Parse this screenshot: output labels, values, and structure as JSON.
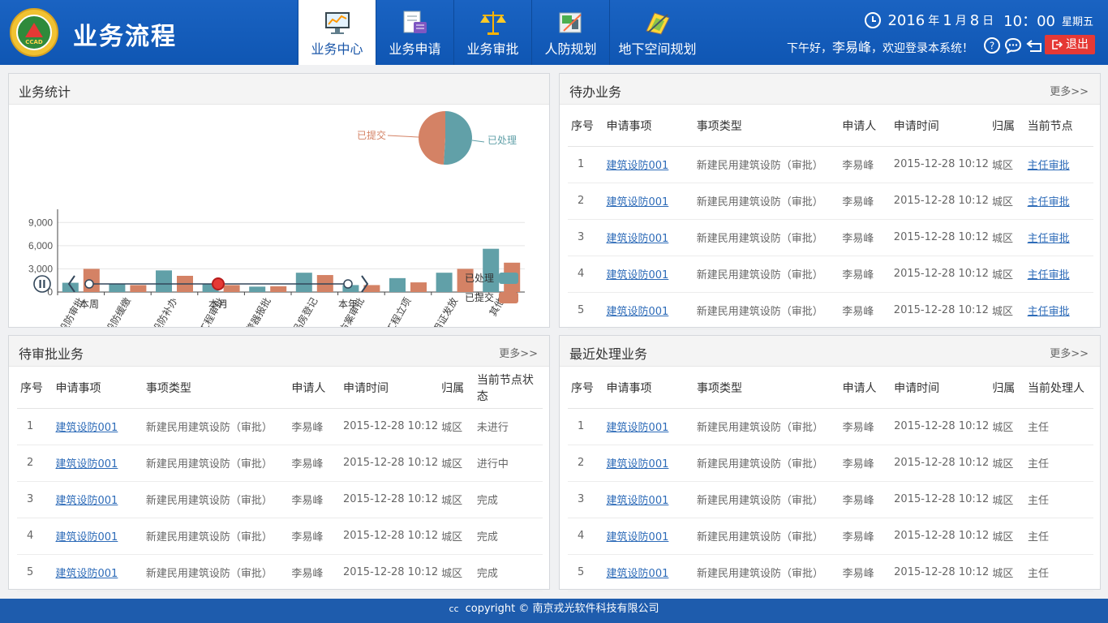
{
  "header": {
    "app_title": "业务流程",
    "logo_text": "CCAD",
    "nav": [
      {
        "label": "业务中心",
        "icon": "monitor-chart-icon",
        "active": true
      },
      {
        "label": "业务申请",
        "icon": "form-edit-icon",
        "active": false
      },
      {
        "label": "业务审批",
        "icon": "scales-icon",
        "active": false
      },
      {
        "label": "人防规划",
        "icon": "planning-tools-icon",
        "active": false
      },
      {
        "label": "地下空间规划",
        "icon": "blueprint-icon",
        "active": false
      }
    ],
    "date": {
      "year": "2016",
      "y": "年",
      "month": "1",
      "m": "月",
      "day": "8",
      "d": "日",
      "time": "10：00",
      "weekday": "星期五"
    },
    "greeting_prefix": "下午好，",
    "user": "李易峰",
    "greeting_suffix": "，欢迎登录本系统！",
    "logout": "退出"
  },
  "stats_panel": {
    "title": "业务统计"
  },
  "chart_data": {
    "type": "bar",
    "categories": [
      "设防审批",
      "设防缓缴",
      "设防补办",
      "工程审批",
      "报警器报批",
      "商品房登记",
      "项目方案审批",
      "工程立项",
      "使用证发放",
      "其他"
    ],
    "series": [
      {
        "name": "已处理",
        "color": "#61a0a8",
        "values": [
          1200,
          1000,
          2800,
          1000,
          700,
          2500,
          900,
          1800,
          2500,
          5600
        ]
      },
      {
        "name": "已提交",
        "color": "#d48265",
        "values": [
          3000,
          900,
          2100,
          900,
          750,
          2200,
          900,
          1250,
          3000,
          3800
        ]
      }
    ],
    "yticks": [
      "0",
      "3,000",
      "6,000",
      "9,000"
    ],
    "ylim": [
      0,
      10500
    ],
    "pie": [
      {
        "name": "已处理",
        "value": 0.51,
        "color": "#61a0a8"
      },
      {
        "name": "已提交",
        "value": 0.49,
        "color": "#d48265"
      }
    ],
    "legend": [
      "已处理",
      "已提交"
    ]
  },
  "timeline": {
    "points": [
      "本周",
      "本月",
      "本年"
    ],
    "current": 1
  },
  "pending_panel": {
    "title": "待办业务",
    "more": "更多>>",
    "headers": [
      "序号",
      "申请事项",
      "事项类型",
      "申请人",
      "申请时间",
      "归属",
      "当前节点"
    ],
    "rows": [
      [
        "1",
        "建筑设防001",
        "新建民用建筑设防（审批）",
        "李易峰",
        "2015-12-28 10:12",
        "城区",
        "主任审批"
      ],
      [
        "2",
        "建筑设防001",
        "新建民用建筑设防（审批）",
        "李易峰",
        "2015-12-28 10:12",
        "城区",
        "主任审批"
      ],
      [
        "3",
        "建筑设防001",
        "新建民用建筑设防（审批）",
        "李易峰",
        "2015-12-28 10:12",
        "城区",
        "主任审批"
      ],
      [
        "4",
        "建筑设防001",
        "新建民用建筑设防（审批）",
        "李易峰",
        "2015-12-28 10:12",
        "城区",
        "主任审批"
      ],
      [
        "5",
        "建筑设防001",
        "新建民用建筑设防（审批）",
        "李易峰",
        "2015-12-28 10:12",
        "城区",
        "主任审批"
      ]
    ]
  },
  "approval_panel": {
    "title": "待审批业务",
    "more": "更多>>",
    "headers": [
      "序号",
      "申请事项",
      "事项类型",
      "申请人",
      "申请时间",
      "归属",
      "当前节点状态"
    ],
    "rows": [
      [
        "1",
        "建筑设防001",
        "新建民用建筑设防（审批）",
        "李易峰",
        "2015-12-28 10:12",
        "城区",
        "未进行"
      ],
      [
        "2",
        "建筑设防001",
        "新建民用建筑设防（审批）",
        "李易峰",
        "2015-12-28 10:12",
        "城区",
        "进行中"
      ],
      [
        "3",
        "建筑设防001",
        "新建民用建筑设防（审批）",
        "李易峰",
        "2015-12-28 10:12",
        "城区",
        "完成"
      ],
      [
        "4",
        "建筑设防001",
        "新建民用建筑设防（审批）",
        "李易峰",
        "2015-12-28 10:12",
        "城区",
        "完成"
      ],
      [
        "5",
        "建筑设防001",
        "新建民用建筑设防（审批）",
        "李易峰",
        "2015-12-28 10:12",
        "城区",
        "完成"
      ]
    ]
  },
  "recent_panel": {
    "title": "最近处理业务",
    "more": "更多>>",
    "headers": [
      "序号",
      "申请事项",
      "事项类型",
      "申请人",
      "申请时间",
      "归属",
      "当前处理人"
    ],
    "rows": [
      [
        "1",
        "建筑设防001",
        "新建民用建筑设防（审批）",
        "李易峰",
        "2015-12-28 10:12",
        "城区",
        "主任"
      ],
      [
        "2",
        "建筑设防001",
        "新建民用建筑设防（审批）",
        "李易峰",
        "2015-12-28 10:12",
        "城区",
        "主任"
      ],
      [
        "3",
        "建筑设防001",
        "新建民用建筑设防（审批）",
        "李易峰",
        "2015-12-28 10:12",
        "城区",
        "主任"
      ],
      [
        "4",
        "建筑设防001",
        "新建民用建筑设防（审批）",
        "李易峰",
        "2015-12-28 10:12",
        "城区",
        "主任"
      ],
      [
        "5",
        "建筑设防001",
        "新建民用建筑设防（审批）",
        "李易峰",
        "2015-12-28 10:12",
        "城区",
        "主任"
      ]
    ]
  },
  "footer": {
    "cc": "cc",
    "text": "copyright © 南京戎光软件科技有限公司"
  }
}
